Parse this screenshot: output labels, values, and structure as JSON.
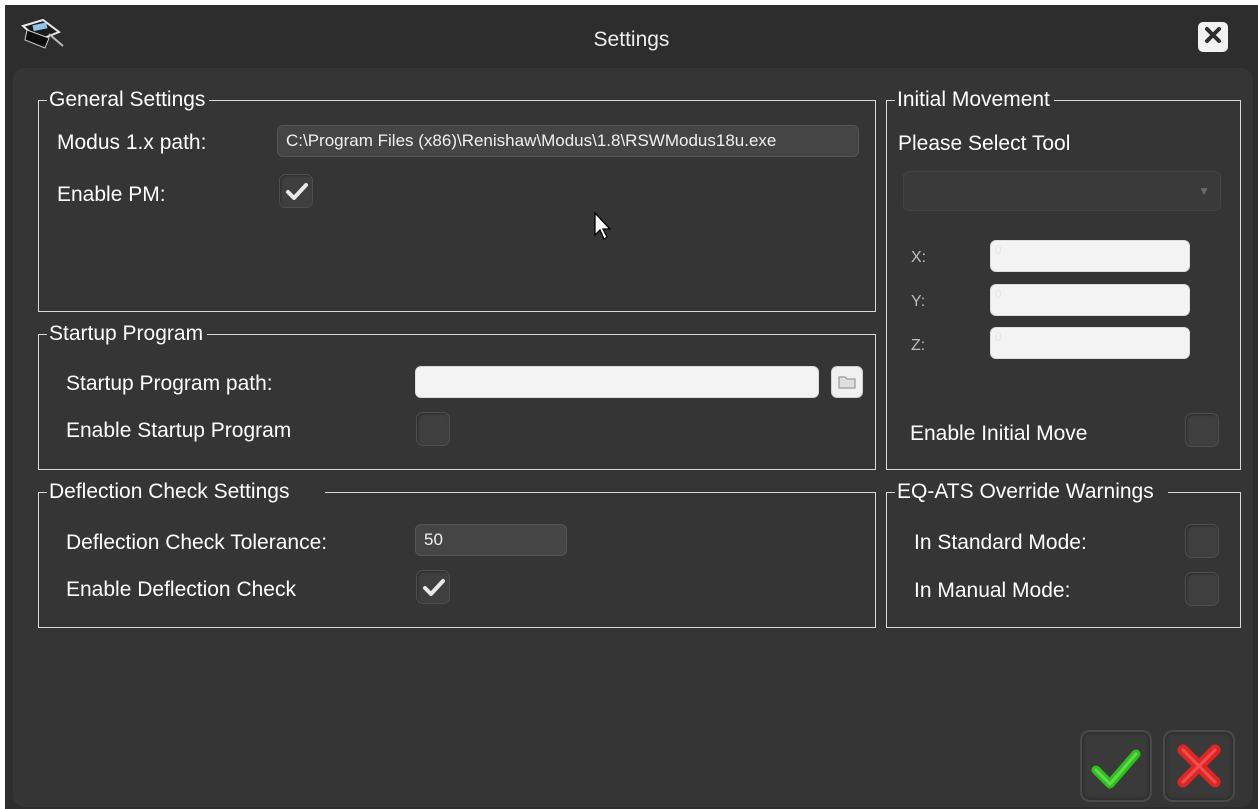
{
  "window": {
    "title": "Settings"
  },
  "general": {
    "title": "General Settings",
    "modus_path_label": "Modus 1.x path:",
    "modus_path_value": "C:\\Program Files (x86)\\Renishaw\\Modus\\1.8\\RSWModus18u.exe",
    "enable_pm_label": "Enable PM:",
    "enable_pm_checked": true
  },
  "startup": {
    "title": "Startup Program",
    "path_label": "Startup Program path:",
    "path_value": "",
    "enable_label": "Enable Startup Program",
    "enable_checked": false
  },
  "deflection": {
    "title": "Deflection Check Settings",
    "tolerance_label": "Deflection Check Tolerance:",
    "tolerance_value": "50",
    "enable_label": "Enable Deflection Check",
    "enable_checked": true
  },
  "initial": {
    "title": "Initial Movement",
    "select_tool_label": "Please Select Tool",
    "selected_tool": "",
    "x_label": "X:",
    "y_label": "Y:",
    "z_label": "Z:",
    "x_value": "0",
    "y_value": "0",
    "z_value": "0",
    "enable_label": "Enable Initial Move",
    "enable_checked": false
  },
  "eqats": {
    "title": "EQ-ATS Override Warnings",
    "standard_label": "In Standard Mode:",
    "manual_label": "In Manual Mode:",
    "standard_checked": false,
    "manual_checked": false
  },
  "colors": {
    "ok": "#2fbf1f",
    "cancel": "#e02525",
    "background": "#353535"
  }
}
